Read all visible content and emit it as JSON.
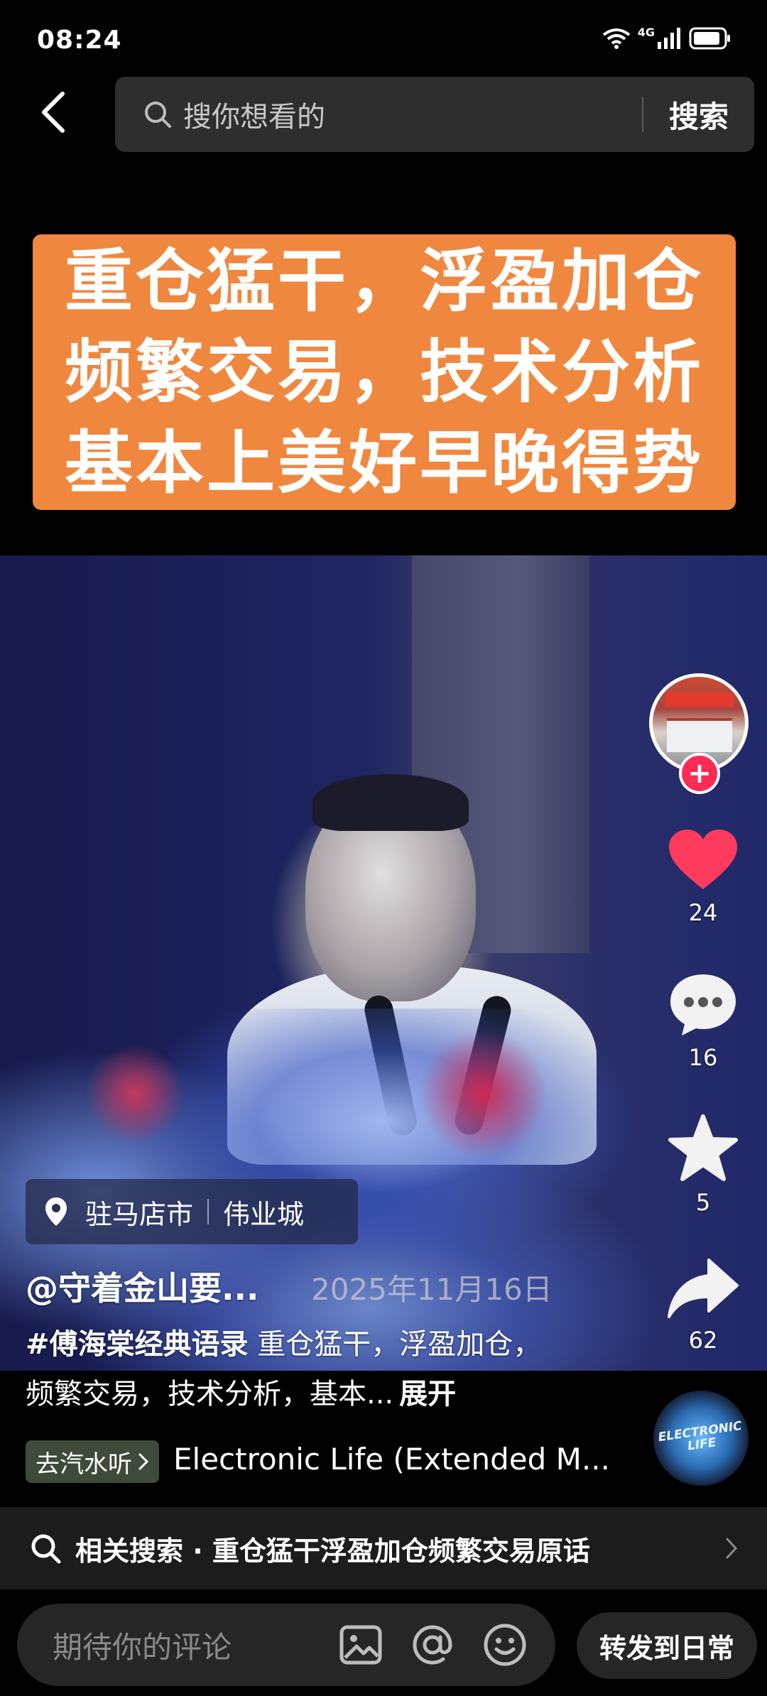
{
  "status_bar": {
    "time": "08:24",
    "network": "4G",
    "icons": [
      "wifi-icon",
      "signal-icon",
      "battery-icon"
    ]
  },
  "top_bar": {
    "search_placeholder": "搜你想看的",
    "search_button": "搜索"
  },
  "video": {
    "banner_lines": [
      "重仓猛干，浮盈加仓",
      "频繁交易，技术分析",
      "基本上美好早晚得势"
    ]
  },
  "actions": {
    "like_count": "24",
    "comment_count": "16",
    "favorite_count": "5",
    "share_count": "62"
  },
  "location": {
    "city": "驻马店市",
    "place": "伟业城"
  },
  "post": {
    "author": "@守着金山要...",
    "date": "2025年11月16日",
    "hashtag": "#傅海棠经典语录",
    "desc_line1": " 重仓猛干，浮盈加仓，",
    "desc_line2": "频繁交易，技术分析，基本...",
    "expand": "展开"
  },
  "music": {
    "tag": "去汽水听",
    "title": "Electronic Life (Extended M...",
    "disc_label": "ELECTRONIC LIFE"
  },
  "related": {
    "text": "相关搜索 · 重仓猛干浮盈加仓频繁交易原话"
  },
  "bottom_bar": {
    "comment_placeholder": "期待你的评论",
    "share_button": "转发到日常"
  },
  "colors": {
    "accent": "#fe2c55",
    "banner": "#f0873f",
    "like": "#fe3b5c"
  }
}
